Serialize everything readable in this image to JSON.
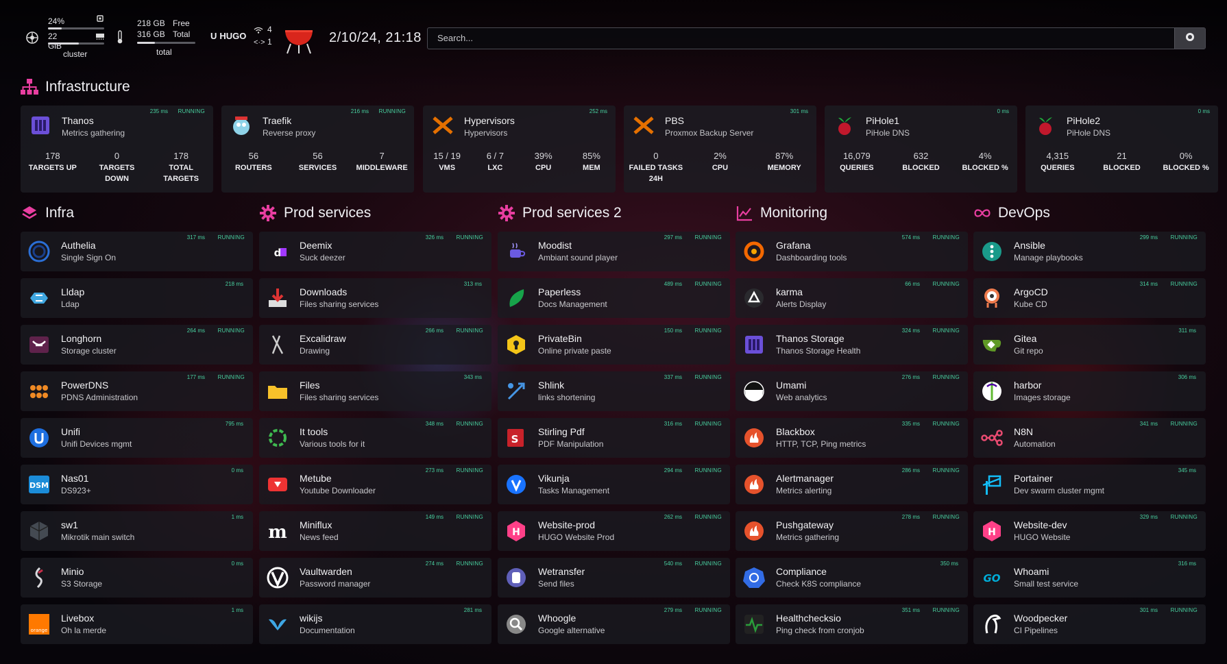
{
  "topbar": {
    "cluster": {
      "cpu": "24%",
      "mem": "22 GiB",
      "label": "cluster",
      "cpu_pct": 24,
      "mem_pct": 55
    },
    "disk": {
      "free": "218 GB",
      "total": "316 GB",
      "free_label": "Free",
      "total_label": "Total",
      "label": "total",
      "used_pct": 31
    },
    "brand": "HUGO",
    "wifi_count": "4",
    "code_count": "1",
    "datetime": "2/10/24, 21:18",
    "search_placeholder": "Search..."
  },
  "infrastructure": {
    "title": "Infrastructure",
    "widgets": [
      {
        "name": "Thanos",
        "desc": "Metrics gathering",
        "ms": "235 ms",
        "status": "RUNNING",
        "icon": "thanos-icon",
        "color": "#6b4fd8",
        "stats": [
          {
            "v": "178",
            "l": "TARGETS UP"
          },
          {
            "v": "0",
            "l": "TARGETS DOWN"
          },
          {
            "v": "178",
            "l": "TOTAL TARGETS"
          }
        ]
      },
      {
        "name": "Traefik",
        "desc": "Reverse proxy",
        "ms": "216 ms",
        "status": "RUNNING",
        "icon": "traefik-gopher-icon",
        "color": "#37a3d9",
        "stats": [
          {
            "v": "56",
            "l": "ROUTERS"
          },
          {
            "v": "56",
            "l": "SERVICES"
          },
          {
            "v": "7",
            "l": "MIDDLEWARE"
          }
        ]
      },
      {
        "name": "Hypervisors",
        "desc": "Hypervisors",
        "ms": "252 ms",
        "status": "",
        "icon": "proxmox-icon",
        "color": "#e57000",
        "stats": [
          {
            "v": "15 / 19",
            "l": "VMS"
          },
          {
            "v": "6 / 7",
            "l": "LXC"
          },
          {
            "v": "39%",
            "l": "CPU"
          },
          {
            "v": "85%",
            "l": "MEM"
          }
        ]
      },
      {
        "name": "PBS",
        "desc": "Proxmox Backup Server",
        "ms": "301 ms",
        "status": "",
        "icon": "proxmox-icon",
        "color": "#e57000",
        "stats": [
          {
            "v": "0",
            "l": "FAILED TASKS 24H"
          },
          {
            "v": "2%",
            "l": "CPU"
          },
          {
            "v": "87%",
            "l": "MEMORY"
          }
        ]
      },
      {
        "name": "PiHole1",
        "desc": "PiHole DNS",
        "ms": "0 ms",
        "status": "",
        "icon": "pihole-icon",
        "color": "#c0182c",
        "stats": [
          {
            "v": "16,079",
            "l": "QUERIES"
          },
          {
            "v": "632",
            "l": "BLOCKED"
          },
          {
            "v": "4%",
            "l": "BLOCKED %"
          }
        ]
      },
      {
        "name": "PiHole2",
        "desc": "PiHole DNS",
        "ms": "0 ms",
        "status": "",
        "icon": "pihole-icon",
        "color": "#c0182c",
        "stats": [
          {
            "v": "4,315",
            "l": "QUERIES"
          },
          {
            "v": "21",
            "l": "BLOCKED"
          },
          {
            "v": "0%",
            "l": "BLOCKED %"
          }
        ]
      }
    ]
  },
  "groups": [
    {
      "title": "Infra",
      "icon": "layers-icon",
      "items": [
        {
          "name": "Authelia",
          "desc": "Single Sign On",
          "ms": "317 ms",
          "status": "RUNNING",
          "icon": "authelia-icon",
          "color": "#2b6fd6"
        },
        {
          "name": "Lldap",
          "desc": "Ldap",
          "ms": "218 ms",
          "status": "",
          "icon": "lldap-icon",
          "color": "#3fa7e0"
        },
        {
          "name": "Longhorn",
          "desc": "Storage cluster",
          "ms": "264 ms",
          "status": "RUNNING",
          "icon": "longhorn-icon",
          "color": "#5f224b"
        },
        {
          "name": "PowerDNS",
          "desc": "PDNS Administration",
          "ms": "177 ms",
          "status": "RUNNING",
          "icon": "powerdns-icon",
          "color": "#f08a24"
        },
        {
          "name": "Unifi",
          "desc": "Unifi Devices mgmt",
          "ms": "795 ms",
          "status": "",
          "icon": "unifi-icon",
          "color": "#1e6fe0"
        },
        {
          "name": "Nas01",
          "desc": "DS923+",
          "ms": "0 ms",
          "status": "",
          "icon": "dsm-icon",
          "color": "#1b8cd8"
        },
        {
          "name": "sw1",
          "desc": "Mikrotik main switch",
          "ms": "1 ms",
          "status": "",
          "icon": "mikrotik-icon",
          "color": "#444a52"
        },
        {
          "name": "Minio",
          "desc": "S3 Storage",
          "ms": "0 ms",
          "status": "",
          "icon": "minio-icon",
          "color": "#d8d8dc"
        },
        {
          "name": "Livebox",
          "desc": "Oh la merde",
          "ms": "1 ms",
          "status": "",
          "icon": "orange-icon",
          "color": "#ff7900"
        }
      ]
    },
    {
      "title": "Prod services",
      "icon": "gear-icon",
      "items": [
        {
          "name": "Deemix",
          "desc": "Suck deezer",
          "ms": "326 ms",
          "status": "RUNNING",
          "icon": "deemix-icon",
          "color": "#a238ff"
        },
        {
          "name": "Downloads",
          "desc": "Files sharing services",
          "ms": "313 ms",
          "status": "",
          "icon": "download-icon",
          "color": "#d33"
        },
        {
          "name": "Excalidraw",
          "desc": "Drawing",
          "ms": "266 ms",
          "status": "RUNNING",
          "icon": "excalidraw-icon",
          "color": "#cccccc"
        },
        {
          "name": "Files",
          "desc": "Files sharing services",
          "ms": "343 ms",
          "status": "",
          "icon": "folder-icon",
          "color": "#f7c12a"
        },
        {
          "name": "It tools",
          "desc": "Various tools for it",
          "ms": "348 ms",
          "status": "RUNNING",
          "icon": "ittools-icon",
          "color": "#3fb950"
        },
        {
          "name": "Metube",
          "desc": "Youtube Downloader",
          "ms": "273 ms",
          "status": "RUNNING",
          "icon": "metube-icon",
          "color": "#e33"
        },
        {
          "name": "Miniflux",
          "desc": "News feed",
          "ms": "149 ms",
          "status": "RUNNING",
          "icon": "miniflux-icon",
          "color": "#ffffff"
        },
        {
          "name": "Vaultwarden",
          "desc": "Password manager",
          "ms": "274 ms",
          "status": "RUNNING",
          "icon": "vaultwarden-icon",
          "color": "#ffffff"
        },
        {
          "name": "wikijs",
          "desc": "Documentation",
          "ms": "281 ms",
          "status": "",
          "icon": "wikijs-icon",
          "color": "#3ea7e4"
        }
      ]
    },
    {
      "title": "Prod services 2",
      "icon": "gear-icon",
      "items": [
        {
          "name": "Moodist",
          "desc": "Ambiant sound player",
          "ms": "297 ms",
          "status": "RUNNING",
          "icon": "moodist-icon",
          "color": "#6a5ae0"
        },
        {
          "name": "Paperless",
          "desc": "Docs Management",
          "ms": "489 ms",
          "status": "RUNNING",
          "icon": "paperless-icon",
          "color": "#17a34a"
        },
        {
          "name": "PrivateBin",
          "desc": "Online private paste",
          "ms": "150 ms",
          "status": "RUNNING",
          "icon": "privatebin-icon",
          "color": "#f5c518"
        },
        {
          "name": "Shlink",
          "desc": "links shortening",
          "ms": "337 ms",
          "status": "RUNNING",
          "icon": "shlink-icon",
          "color": "#4696e5"
        },
        {
          "name": "Stirling Pdf",
          "desc": "PDF Manipulation",
          "ms": "316 ms",
          "status": "RUNNING",
          "icon": "stirling-pdf-icon",
          "color": "#c8222a"
        },
        {
          "name": "Vikunja",
          "desc": "Tasks Management",
          "ms": "294 ms",
          "status": "RUNNING",
          "icon": "vikunja-icon",
          "color": "#1973ff"
        },
        {
          "name": "Website-prod",
          "desc": "HUGO Website Prod",
          "ms": "262 ms",
          "status": "RUNNING",
          "icon": "hugo-icon",
          "color": "#ff4088"
        },
        {
          "name": "Wetransfer",
          "desc": "Send files",
          "ms": "540 ms",
          "status": "RUNNING",
          "icon": "wetransfer-icon",
          "color": "#5f5fb8"
        },
        {
          "name": "Whoogle",
          "desc": "Google alternative",
          "ms": "279 ms",
          "status": "RUNNING",
          "icon": "search-magnifier-icon",
          "color": "#888"
        }
      ]
    },
    {
      "title": "Monitoring",
      "icon": "chart-line-icon",
      "items": [
        {
          "name": "Grafana",
          "desc": "Dashboarding tools",
          "ms": "574 ms",
          "status": "RUNNING",
          "icon": "grafana-icon",
          "color": "#f46800"
        },
        {
          "name": "karma",
          "desc": "Alerts Display",
          "ms": "66 ms",
          "status": "RUNNING",
          "icon": "karma-icon",
          "color": "#333"
        },
        {
          "name": "Thanos Storage",
          "desc": "Thanos Storage Health",
          "ms": "324 ms",
          "status": "RUNNING",
          "icon": "thanos-icon",
          "color": "#6b4fd8"
        },
        {
          "name": "Umami",
          "desc": "Web analytics",
          "ms": "276 ms",
          "status": "RUNNING",
          "icon": "umami-icon",
          "color": "#ffffff"
        },
        {
          "name": "Blackbox",
          "desc": "HTTP, TCP, Ping metrics",
          "ms": "335 ms",
          "status": "RUNNING",
          "icon": "prometheus-icon",
          "color": "#e6522c"
        },
        {
          "name": "Alertmanager",
          "desc": "Metrics alerting",
          "ms": "286 ms",
          "status": "RUNNING",
          "icon": "prometheus-icon",
          "color": "#e6522c"
        },
        {
          "name": "Pushgateway",
          "desc": "Metrics gathering",
          "ms": "278 ms",
          "status": "RUNNING",
          "icon": "prometheus-icon",
          "color": "#e6522c"
        },
        {
          "name": "Compliance",
          "desc": "Check K8S compliance",
          "ms": "350 ms",
          "status": "",
          "icon": "kubernetes-icon",
          "color": "#326ce5"
        },
        {
          "name": "Healthchecksio",
          "desc": "Ping check from cronjob",
          "ms": "351 ms",
          "status": "RUNNING",
          "icon": "healthchecks-icon",
          "color": "#2a9d3b"
        }
      ]
    },
    {
      "title": "DevOps",
      "icon": "infinity-icon",
      "items": [
        {
          "name": "Ansible",
          "desc": "Manage playbooks",
          "ms": "299 ms",
          "status": "RUNNING",
          "icon": "ansible-icon",
          "color": "#1a9a8a"
        },
        {
          "name": "ArgoCD",
          "desc": "Kube CD",
          "ms": "314 ms",
          "status": "RUNNING",
          "icon": "argocd-icon",
          "color": "#ef7b4d"
        },
        {
          "name": "Gitea",
          "desc": "Git repo",
          "ms": "311 ms",
          "status": "",
          "icon": "gitea-icon",
          "color": "#609926"
        },
        {
          "name": "harbor",
          "desc": "Images storage",
          "ms": "306 ms",
          "status": "",
          "icon": "harbor-icon",
          "color": "#60b932"
        },
        {
          "name": "N8N",
          "desc": "Automation",
          "ms": "341 ms",
          "status": "RUNNING",
          "icon": "n8n-icon",
          "color": "#ea4b71"
        },
        {
          "name": "Portainer",
          "desc": "Dev swarm cluster mgmt",
          "ms": "345 ms",
          "status": "",
          "icon": "portainer-icon",
          "color": "#13bef9"
        },
        {
          "name": "Website-dev",
          "desc": "HUGO Website",
          "ms": "329 ms",
          "status": "RUNNING",
          "icon": "hugo-icon",
          "color": "#ff4088"
        },
        {
          "name": "Whoami",
          "desc": "Small test service",
          "ms": "316 ms",
          "status": "",
          "icon": "go-icon",
          "color": "#00add8"
        },
        {
          "name": "Woodpecker",
          "desc": "CI Pipelines",
          "ms": "301 ms",
          "status": "RUNNING",
          "icon": "woodpecker-icon",
          "color": "#ffffff"
        }
      ]
    }
  ]
}
